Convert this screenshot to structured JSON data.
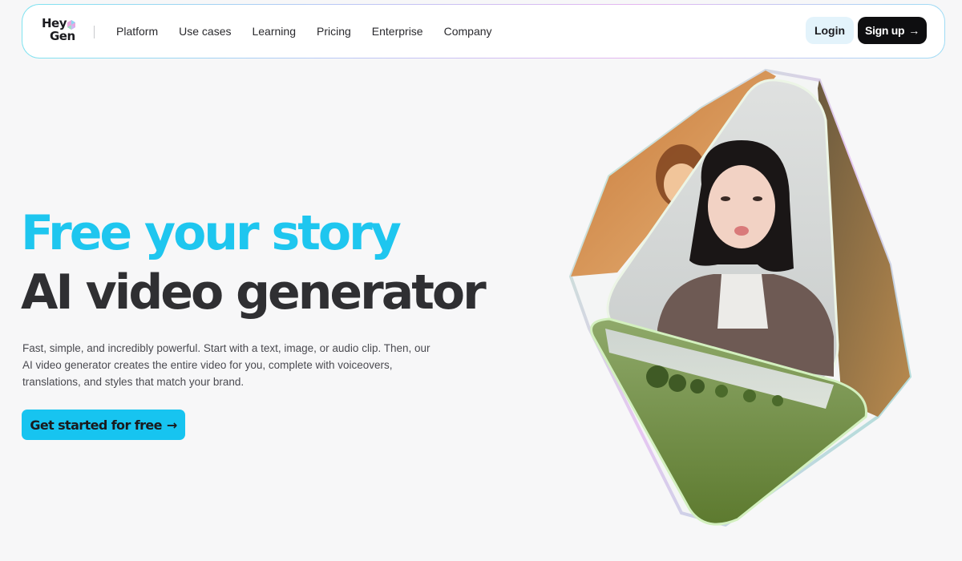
{
  "brand": {
    "logo_line1": "Hey",
    "logo_line2": "Gen"
  },
  "nav": {
    "links": [
      "Platform",
      "Use cases",
      "Learning",
      "Pricing",
      "Enterprise",
      "Company"
    ],
    "login_label": "Login",
    "signup_label": "Sign up",
    "signup_icon": "arrow-right-icon"
  },
  "hero": {
    "headline_1": "Free your story",
    "headline_2": "AI video generator",
    "description": "Fast, simple, and incredibly powerful. Start with a text, image, or audio clip. Then, our AI video generator creates the entire video for you, complete with voiceovers, translations, and styles that match your brand.",
    "cta_label": "Get started for free",
    "cta_icon": "arrow-right-icon"
  },
  "colors": {
    "accent_cyan": "#1ec6ef",
    "cta_bg": "#17c4f0",
    "signup_bg": "#0e0e10",
    "login_bg": "#e3f3fb",
    "headline_dark": "#2f2f32"
  }
}
